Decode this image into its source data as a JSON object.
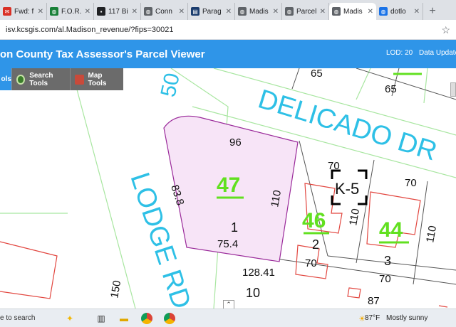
{
  "browser": {
    "tabs": [
      {
        "label": "Fwd: f",
        "fav_color": "#d93025",
        "fav_icon": "mail-icon"
      },
      {
        "label": "F.O.R.",
        "fav_color": "#188038",
        "fav_icon": "globe-icon"
      },
      {
        "label": "117 Bi",
        "fav_color": "#202124",
        "fav_icon": "page-icon"
      },
      {
        "label": "Conn",
        "fav_color": "#5f6368",
        "fav_icon": "globe-icon"
      },
      {
        "label": "Parag",
        "fav_color": "#1a3c6e",
        "fav_icon": "chart-icon"
      },
      {
        "label": "Madis",
        "fav_color": "#5f6368",
        "fav_icon": "globe-icon"
      },
      {
        "label": "Parcel",
        "fav_color": "#5f6368",
        "fav_icon": "globe-icon"
      },
      {
        "label": "Madis",
        "fav_color": "#5f6368",
        "fav_icon": "globe-icon",
        "active": true
      },
      {
        "label": "dotlo",
        "fav_color": "#1a73e8",
        "fav_icon": "globe-icon"
      }
    ],
    "new_tab": "+",
    "url": "isv.kcsgis.com/al.Madison_revenue/?fips=30021"
  },
  "app": {
    "title": "on County Tax Assessor's Parcel Viewer",
    "lod": "LOD: 20",
    "updated": "Data Updated",
    "accent": "#2f95e8"
  },
  "toolbar": {
    "first_label": "ols",
    "search_label": "Search Tools",
    "map_label": "Map Tools"
  },
  "map": {
    "streets": [
      {
        "name": "DELICADO DR",
        "color": "#2ec0e6"
      },
      {
        "name": "LODGE RD",
        "color": "#2ec0e6"
      },
      {
        "name": "50",
        "color": "#2ec0e6"
      }
    ],
    "lots": [
      {
        "number": "47",
        "color": "#62e020"
      },
      {
        "number": "46",
        "color": "#62e020"
      },
      {
        "number": "44",
        "color": "#62e020"
      }
    ],
    "block": "K-5",
    "parcels": [
      "1",
      "2",
      "3",
      "10"
    ],
    "dimensions": [
      "65",
      "65",
      "96",
      "83.8",
      "110",
      "75.4",
      "70",
      "70",
      "110",
      "110",
      "70",
      "70",
      "128.41",
      "150",
      "87"
    ],
    "selected_fill": "#f7e4f7"
  },
  "taskbar": {
    "search": "e to search",
    "temperature": "87°F",
    "condition": "Mostly sunny"
  }
}
